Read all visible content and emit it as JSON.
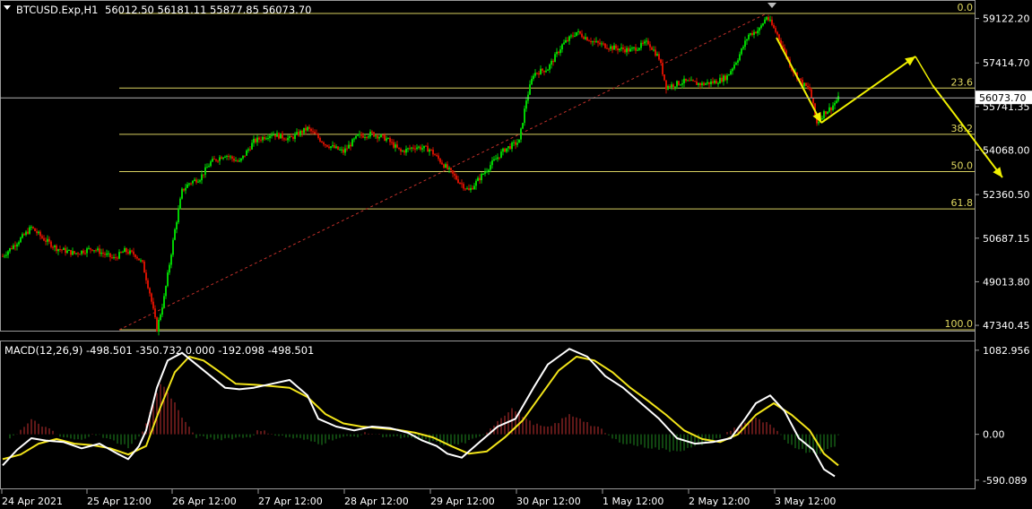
{
  "chart_data": {
    "type": "candlestick",
    "symbol_header": {
      "symbol": "BTCUSD.Exp,H1",
      "ohlc": "56012.50 56181.11 55877.85 56073.70"
    },
    "price_axis": {
      "ticks": [
        "59122.20",
        "57414.70",
        "55741.35",
        "54068.00",
        "52360.50",
        "50687.15",
        "49013.80",
        "47340.45"
      ],
      "current_price": "56073.70",
      "ylim": [
        47000,
        59500
      ]
    },
    "time_axis": {
      "labels": [
        "24 Apr 2021",
        "25 Apr 12:00",
        "26 Apr 12:00",
        "27 Apr 12:00",
        "28 Apr 12:00",
        "29 Apr 12:00",
        "30 Apr 12:00",
        "1 May 12:00",
        "2 May 12:00",
        "3 May 12:00"
      ]
    },
    "fibonacci": {
      "high": 59315,
      "low": 47170,
      "levels": [
        {
          "label": "0.0",
          "ratio": 0
        },
        {
          "label": "23.6",
          "ratio": 0.236
        },
        {
          "label": "38.2",
          "ratio": 0.382
        },
        {
          "label": "50.0",
          "ratio": 0.5
        },
        {
          "label": "61.8",
          "ratio": 0.618
        },
        {
          "label": "100.0",
          "ratio": 1
        }
      ]
    },
    "price_path": {
      "description_points": [
        [
          0,
          50000
        ],
        [
          6,
          50400
        ],
        [
          12,
          50800
        ],
        [
          16,
          51100
        ],
        [
          22,
          50700
        ],
        [
          30,
          50300
        ],
        [
          40,
          50100
        ],
        [
          50,
          50300
        ],
        [
          62,
          49900
        ],
        [
          68,
          50200
        ],
        [
          74,
          50050
        ],
        [
          78,
          49700
        ],
        [
          82,
          48600
        ],
        [
          86,
          47200
        ],
        [
          90,
          48400
        ],
        [
          96,
          51000
        ],
        [
          100,
          52500
        ],
        [
          104,
          52800
        ],
        [
          110,
          53000
        ],
        [
          116,
          53600
        ],
        [
          124,
          53900
        ],
        [
          132,
          53600
        ],
        [
          140,
          54400
        ],
        [
          150,
          54700
        ],
        [
          160,
          54500
        ],
        [
          170,
          54900
        ],
        [
          180,
          54300
        ],
        [
          190,
          54000
        ],
        [
          198,
          54600
        ],
        [
          206,
          54700
        ],
        [
          214,
          54500
        ],
        [
          222,
          54000
        ],
        [
          230,
          54200
        ],
        [
          238,
          54100
        ],
        [
          246,
          53500
        ],
        [
          254,
          52900
        ],
        [
          260,
          52500
        ],
        [
          266,
          53000
        ],
        [
          272,
          53500
        ],
        [
          280,
          54100
        ],
        [
          288,
          54400
        ],
        [
          292,
          56000
        ],
        [
          296,
          57000
        ],
        [
          304,
          57200
        ],
        [
          312,
          58100
        ],
        [
          320,
          58600
        ],
        [
          330,
          58200
        ],
        [
          340,
          58000
        ],
        [
          350,
          57900
        ],
        [
          360,
          58200
        ],
        [
          366,
          57600
        ],
        [
          370,
          56500
        ],
        [
          380,
          56700
        ],
        [
          390,
          56600
        ],
        [
          398,
          56700
        ],
        [
          404,
          56900
        ],
        [
          410,
          57600
        ],
        [
          416,
          58500
        ],
        [
          422,
          58700
        ],
        [
          426,
          59200
        ],
        [
          432,
          58500
        ],
        [
          440,
          57200
        ],
        [
          446,
          56600
        ],
        [
          450,
          56400
        ],
        [
          454,
          55100
        ],
        [
          458,
          55500
        ],
        [
          462,
          55700
        ],
        [
          466,
          56050
        ]
      ]
    },
    "macd": {
      "label": "MACD(12,26,9) -498.501 -350.732 0.000 -192.098 -498.501",
      "ticks": [
        "1082.956",
        "0.00",
        "-590.089"
      ],
      "ylim": [
        -650,
        1150
      ],
      "main_line": [
        [
          0,
          -400
        ],
        [
          8,
          -200
        ],
        [
          16,
          -50
        ],
        [
          24,
          -80
        ],
        [
          34,
          -100
        ],
        [
          44,
          -180
        ],
        [
          54,
          -120
        ],
        [
          64,
          -250
        ],
        [
          70,
          -320
        ],
        [
          76,
          -150
        ],
        [
          80,
          50
        ],
        [
          86,
          600
        ],
        [
          92,
          950
        ],
        [
          100,
          1050
        ],
        [
          108,
          900
        ],
        [
          116,
          750
        ],
        [
          124,
          600
        ],
        [
          132,
          580
        ],
        [
          140,
          600
        ],
        [
          150,
          650
        ],
        [
          160,
          700
        ],
        [
          170,
          500
        ],
        [
          176,
          200
        ],
        [
          186,
          100
        ],
        [
          196,
          50
        ],
        [
          206,
          100
        ],
        [
          216,
          80
        ],
        [
          226,
          20
        ],
        [
          234,
          -80
        ],
        [
          242,
          -150
        ],
        [
          248,
          -250
        ],
        [
          256,
          -300
        ],
        [
          266,
          -100
        ],
        [
          276,
          100
        ],
        [
          286,
          200
        ],
        [
          296,
          600
        ],
        [
          304,
          900
        ],
        [
          310,
          1000
        ],
        [
          316,
          1100
        ],
        [
          326,
          1000
        ],
        [
          336,
          750
        ],
        [
          346,
          600
        ],
        [
          356,
          400
        ],
        [
          366,
          200
        ],
        [
          376,
          -50
        ],
        [
          386,
          -120
        ],
        [
          396,
          -100
        ],
        [
          406,
          -50
        ],
        [
          414,
          200
        ],
        [
          420,
          400
        ],
        [
          428,
          500
        ],
        [
          436,
          300
        ],
        [
          444,
          -50
        ],
        [
          452,
          -200
        ],
        [
          458,
          -450
        ],
        [
          464,
          -540
        ]
      ],
      "signal_line": [
        [
          0,
          -320
        ],
        [
          10,
          -260
        ],
        [
          20,
          -120
        ],
        [
          30,
          -60
        ],
        [
          40,
          -120
        ],
        [
          50,
          -140
        ],
        [
          60,
          -180
        ],
        [
          70,
          -260
        ],
        [
          80,
          -150
        ],
        [
          88,
          350
        ],
        [
          96,
          800
        ],
        [
          104,
          1000
        ],
        [
          112,
          950
        ],
        [
          120,
          820
        ],
        [
          130,
          650
        ],
        [
          140,
          640
        ],
        [
          150,
          620
        ],
        [
          160,
          600
        ],
        [
          170,
          480
        ],
        [
          180,
          260
        ],
        [
          190,
          140
        ],
        [
          200,
          100
        ],
        [
          210,
          80
        ],
        [
          220,
          60
        ],
        [
          230,
          20
        ],
        [
          240,
          -40
        ],
        [
          250,
          -150
        ],
        [
          260,
          -250
        ],
        [
          270,
          -220
        ],
        [
          280,
          -40
        ],
        [
          290,
          180
        ],
        [
          300,
          500
        ],
        [
          310,
          820
        ],
        [
          320,
          1000
        ],
        [
          330,
          950
        ],
        [
          340,
          800
        ],
        [
          350,
          600
        ],
        [
          360,
          430
        ],
        [
          370,
          250
        ],
        [
          380,
          50
        ],
        [
          390,
          -60
        ],
        [
          400,
          -100
        ],
        [
          410,
          0
        ],
        [
          420,
          250
        ],
        [
          430,
          400
        ],
        [
          440,
          250
        ],
        [
          450,
          50
        ],
        [
          458,
          -250
        ],
        [
          466,
          -400
        ]
      ],
      "histogram": [
        [
          4,
          -40
        ],
        [
          10,
          50
        ],
        [
          16,
          180
        ],
        [
          20,
          140
        ],
        [
          26,
          60
        ],
        [
          32,
          -30
        ],
        [
          38,
          -60
        ],
        [
          44,
          -80
        ],
        [
          50,
          20
        ],
        [
          56,
          -40
        ],
        [
          62,
          -90
        ],
        [
          66,
          -120
        ],
        [
          70,
          -160
        ],
        [
          76,
          -40
        ],
        [
          80,
          150
        ],
        [
          84,
          400
        ],
        [
          88,
          650
        ],
        [
          92,
          550
        ],
        [
          96,
          400
        ],
        [
          100,
          220
        ],
        [
          104,
          80
        ],
        [
          108,
          -30
        ],
        [
          114,
          -50
        ],
        [
          120,
          -60
        ],
        [
          126,
          -50
        ],
        [
          132,
          -40
        ],
        [
          138,
          -30
        ],
        [
          142,
          40
        ],
        [
          148,
          30
        ],
        [
          154,
          -20
        ],
        [
          160,
          -40
        ],
        [
          166,
          -60
        ],
        [
          172,
          -90
        ],
        [
          178,
          -120
        ],
        [
          184,
          -60
        ],
        [
          190,
          -40
        ],
        [
          196,
          -30
        ],
        [
          204,
          20
        ],
        [
          212,
          -20
        ],
        [
          220,
          -40
        ],
        [
          228,
          -60
        ],
        [
          236,
          -80
        ],
        [
          242,
          -110
        ],
        [
          248,
          -140
        ],
        [
          254,
          -130
        ],
        [
          260,
          -90
        ],
        [
          266,
          -40
        ],
        [
          272,
          80
        ],
        [
          278,
          220
        ],
        [
          284,
          330
        ],
        [
          290,
          240
        ],
        [
          294,
          160
        ],
        [
          298,
          120
        ],
        [
          304,
          80
        ],
        [
          310,
          160
        ],
        [
          316,
          250
        ],
        [
          322,
          210
        ],
        [
          328,
          120
        ],
        [
          334,
          60
        ],
        [
          340,
          -60
        ],
        [
          348,
          -120
        ],
        [
          356,
          -150
        ],
        [
          364,
          -180
        ],
        [
          372,
          -210
        ],
        [
          380,
          -200
        ],
        [
          388,
          -150
        ],
        [
          394,
          -80
        ],
        [
          400,
          -40
        ],
        [
          408,
          80
        ],
        [
          414,
          160
        ],
        [
          420,
          200
        ],
        [
          426,
          140
        ],
        [
          430,
          80
        ],
        [
          436,
          -80
        ],
        [
          442,
          -160
        ],
        [
          448,
          -220
        ],
        [
          454,
          -240
        ],
        [
          458,
          -220
        ],
        [
          464,
          -150
        ]
      ]
    }
  }
}
